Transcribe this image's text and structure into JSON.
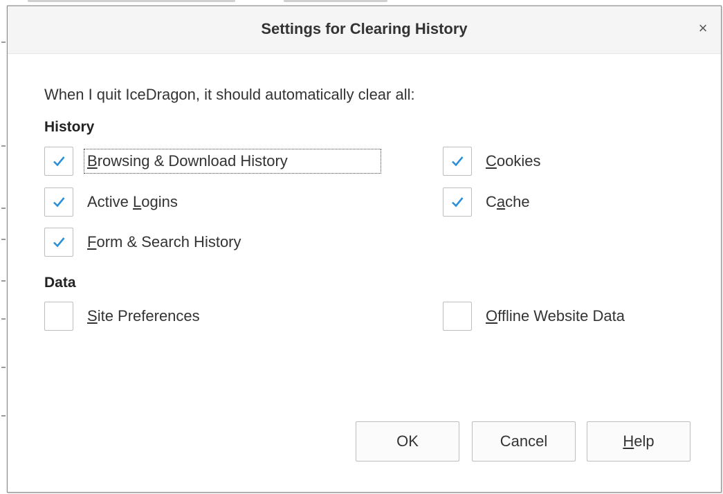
{
  "dialog": {
    "title": "Settings for Clearing History",
    "close_glyph": "×",
    "intro": "When I quit IceDragon, it should automatically clear all:"
  },
  "sections": {
    "history": "History",
    "data": "Data"
  },
  "options": {
    "browsing_download_history": {
      "label": "Browsing & Download History",
      "access_key": "B",
      "checked": true
    },
    "cookies": {
      "label": "Cookies",
      "access_key": "C",
      "checked": true
    },
    "active_logins": {
      "label": "Active Logins",
      "access_key": "L",
      "checked": true
    },
    "cache": {
      "label": "Cache",
      "access_key": "a",
      "checked": true
    },
    "form_search_history": {
      "label": "Form & Search History",
      "access_key": "F",
      "checked": true
    },
    "site_preferences": {
      "label": "Site Preferences",
      "access_key": "S",
      "checked": false
    },
    "offline_website_data": {
      "label": "Offline Website Data",
      "access_key": "O",
      "checked": false
    }
  },
  "buttons": {
    "ok": "OK",
    "cancel": "Cancel",
    "help": "Help",
    "help_access_key": "H"
  },
  "colors": {
    "checkmark": "#2a8fd6",
    "title_bar": "#f5f5f5"
  },
  "icons": {
    "close": "close-icon",
    "check": "checkmark-icon"
  }
}
